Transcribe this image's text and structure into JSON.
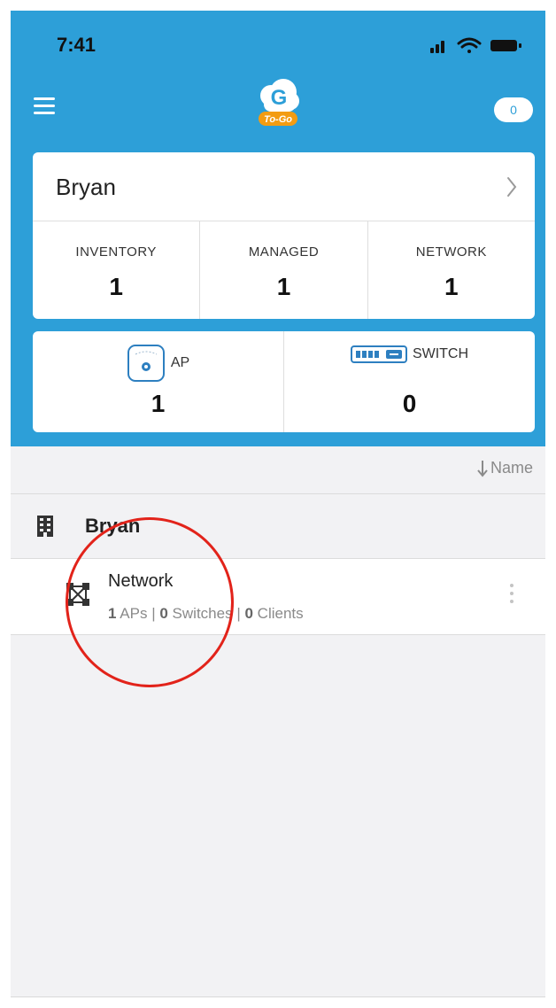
{
  "status_bar": {
    "time": "7:41",
    "icons": [
      "signal-icon",
      "wifi-icon",
      "battery-icon"
    ]
  },
  "header": {
    "logo_letter": "G",
    "logo_tagline": "To-Go",
    "notification_count": "0"
  },
  "organization": {
    "name": "Bryan",
    "stats": [
      {
        "label": "INVENTORY",
        "value": "1"
      },
      {
        "label": "MANAGED",
        "value": "1"
      },
      {
        "label": "NETWORK",
        "value": "1"
      }
    ]
  },
  "devices": [
    {
      "label": "AP",
      "value": "1",
      "icon": "access-point-icon"
    },
    {
      "label": "SWITCH",
      "value": "0",
      "icon": "switch-icon"
    }
  ],
  "sort": {
    "label": "Name",
    "icon": "sort-down-icon"
  },
  "group": {
    "name": "Bryan",
    "icon": "building-icon"
  },
  "network_item": {
    "title": "Network",
    "icon": "network-topology-icon",
    "aps_count": "1",
    "aps_label": "APs",
    "switches_count": "0",
    "switches_label": "Switches",
    "clients_count": "0",
    "clients_label": "Clients",
    "separator": "|"
  },
  "colors": {
    "header_bg": "#2d9fd8",
    "annotation": "#e2231a",
    "logo_orange": "#f39c12"
  }
}
